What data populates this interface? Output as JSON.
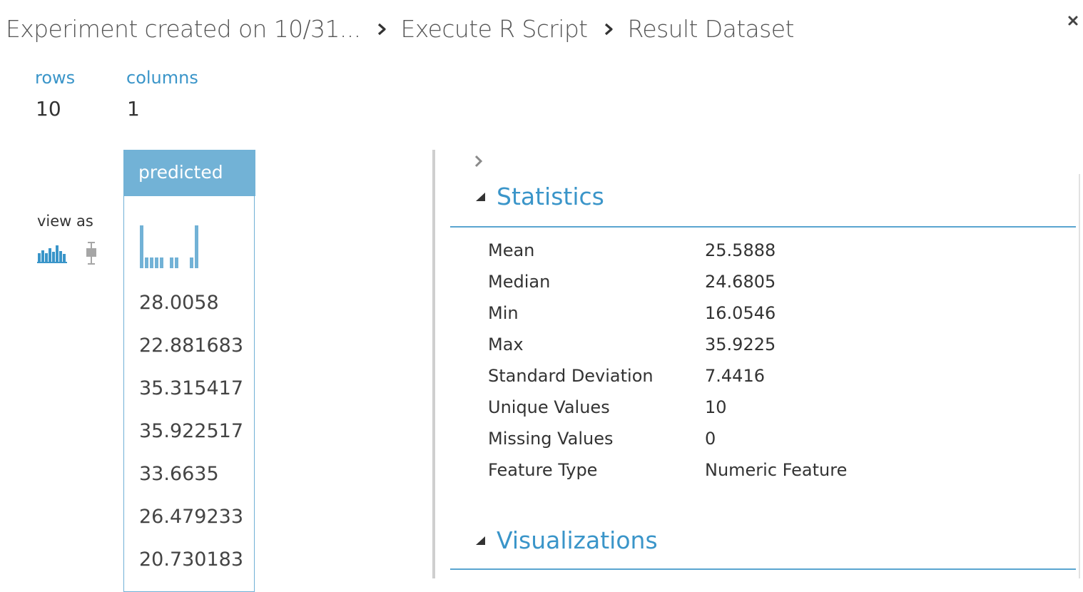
{
  "breadcrumb": {
    "items": [
      "Experiment created on 10/31...",
      "Execute R Script",
      "Result Dataset"
    ]
  },
  "dataset": {
    "rows_label": "rows",
    "rows_value": "10",
    "columns_label": "columns",
    "columns_value": "1"
  },
  "view_as": {
    "label": "view as",
    "options": [
      "histogram-icon",
      "boxplot-icon"
    ],
    "selected": "histogram-icon"
  },
  "column": {
    "name": "predicted",
    "mini_histogram_counts": [
      4,
      1,
      1,
      1,
      1,
      0,
      1,
      1,
      0,
      0,
      1,
      4
    ],
    "values": [
      "28.0058",
      "22.881683",
      "35.315417",
      "35.922517",
      "33.6635",
      "26.479233",
      "20.730183"
    ]
  },
  "statistics": {
    "title": "Statistics",
    "rows": [
      {
        "label": "Mean",
        "value": "25.5888"
      },
      {
        "label": "Median",
        "value": "24.6805"
      },
      {
        "label": "Min",
        "value": "16.0546"
      },
      {
        "label": "Max",
        "value": "35.9225"
      },
      {
        "label": "Standard Deviation",
        "value": "7.4416"
      },
      {
        "label": "Unique Values",
        "value": "10"
      },
      {
        "label": "Missing Values",
        "value": "0"
      },
      {
        "label": "Feature Type",
        "value": "Numeric Feature"
      }
    ]
  },
  "visualizations": {
    "title": "Visualizations"
  },
  "colors": {
    "accent": "#3a95c9",
    "column_header_bg": "#72b2d6",
    "text": "#333333"
  }
}
